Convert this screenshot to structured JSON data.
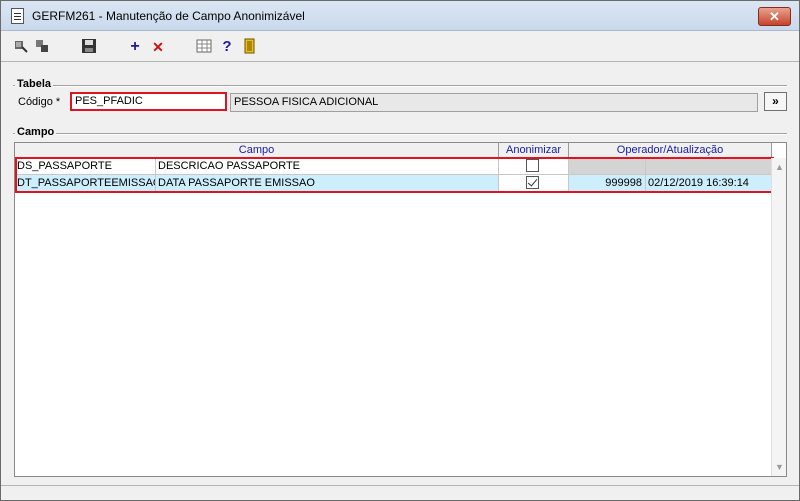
{
  "window": {
    "title": "GERFM261 - Manutenção de Campo Anonimizável",
    "close_label": "✕"
  },
  "toolbar": {
    "icons": [
      "import-icon",
      "export-icon",
      "save-icon",
      "add-icon",
      "delete-icon",
      "grid-icon",
      "help-icon",
      "exit-icon"
    ],
    "add_label": "+",
    "delete_label": "✕",
    "help_label": "?"
  },
  "tabela": {
    "group_label": "Tabela",
    "codigo_label": "Código *",
    "codigo_value": "PES_PFADIC",
    "descricao_value": "PESSOA FISICA ADICIONAL",
    "lookup_label": "»"
  },
  "campo": {
    "group_label": "Campo",
    "headers": {
      "campo": "Campo",
      "anonimizar": "Anonimizar",
      "operador": "Operador/Atualização"
    },
    "rows": [
      {
        "codigo": "DS_PASSAPORTE",
        "descricao": "DESCRICAO PASSAPORTE",
        "anonimizar": false,
        "operador": "",
        "atualizacao": ""
      },
      {
        "codigo": "DT_PASSAPORTEEMISSAO",
        "descricao": "DATA PASSAPORTE EMISSAO",
        "anonimizar": true,
        "operador": "999998",
        "atualizacao": "02/12/2019 16:39:14"
      }
    ]
  },
  "scrollbar": {
    "up": "▲",
    "down": "▼"
  },
  "colors": {
    "highlight_border": "#e0141e",
    "selected_row": "#cdeefc",
    "header_text": "#1a1aa6"
  }
}
